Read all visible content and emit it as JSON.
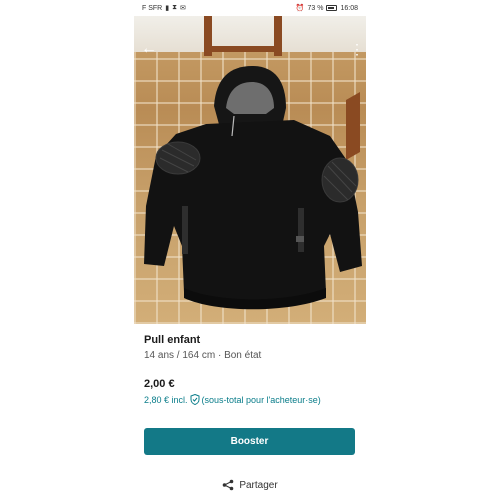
{
  "status_bar": {
    "carrier": "F SFR",
    "battery": "73 %",
    "time": "16:08"
  },
  "listing": {
    "title": "Pull enfant",
    "size": "14 ans / 164 cm",
    "separator": "·",
    "condition": "Bon état",
    "price": "2,00 €",
    "price_incl": "2,80 € incl.",
    "protection_note": "(sous-total pour l'acheteur·se)"
  },
  "actions": {
    "primary_label": "Booster",
    "share_label": "Partager"
  },
  "icons": [
    "back-arrow-icon",
    "more-vertical-icon",
    "shield-check-icon",
    "share-icon",
    "battery-icon"
  ],
  "colors": {
    "accent": "#137987",
    "link": "#0a7d8a"
  }
}
